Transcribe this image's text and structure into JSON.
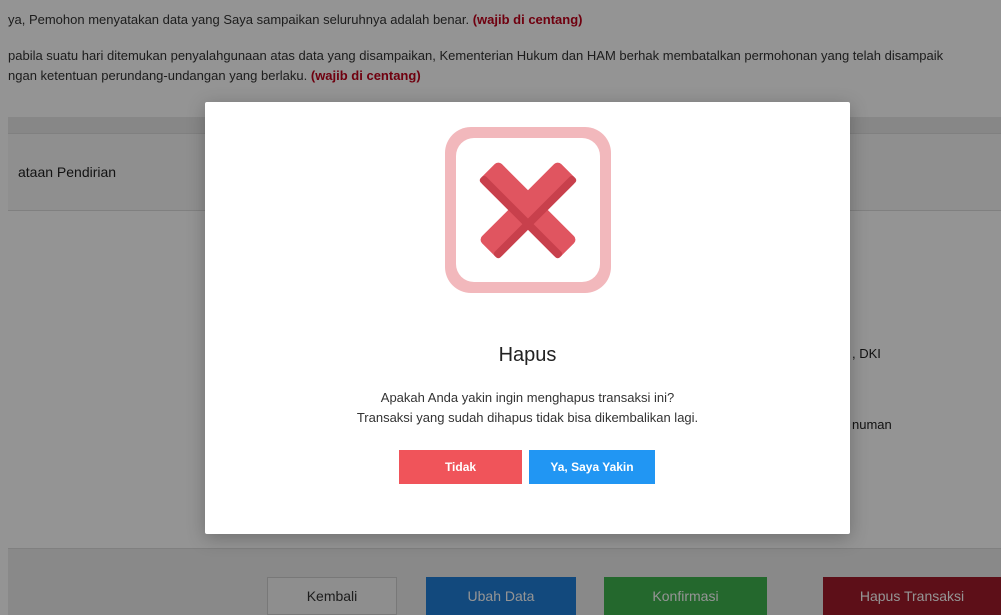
{
  "background": {
    "declarations": [
      {
        "text": "ya, Pemohon menyatakan data yang Saya sampaikan seluruhnya adalah benar. ",
        "required": "(wajib di centang)"
      },
      {
        "text": "pabila suatu hari ditemukan penyalahgunaan atas data yang disampaikan, Kementerian Hukum dan HAM berhak membatalkan permohonan yang telah disampaik",
        "required": ""
      },
      {
        "text": "ngan ketentuan perundang-undangan yang berlaku. ",
        "required": "(wajib di centang)"
      }
    ],
    "section_title": "ataan Pendirian",
    "fragment_dki": ", DKI",
    "fragment_numan": "numan",
    "actions": {
      "kembali": "Kembali",
      "ubah_data": "Ubah Data",
      "konfirmasi": "Konfirmasi",
      "hapus_transaksi": "Hapus Transaksi"
    }
  },
  "modal": {
    "icon": "x-mark-icon",
    "title": "Hapus",
    "message_line1": "Apakah Anda yakin ingin menghapus transaksi ini?",
    "message_line2": "Transaksi yang sudah dihapus tidak bisa dikembalikan lagi.",
    "cancel_label": "Tidak",
    "confirm_label": "Ya, Saya Yakin"
  },
  "colors": {
    "required_text": "#c0001a",
    "cancel_button": "#f0545a",
    "confirm_button": "#2196f3",
    "icon_red": "#e05560",
    "icon_frame": "#f2b8bc"
  }
}
